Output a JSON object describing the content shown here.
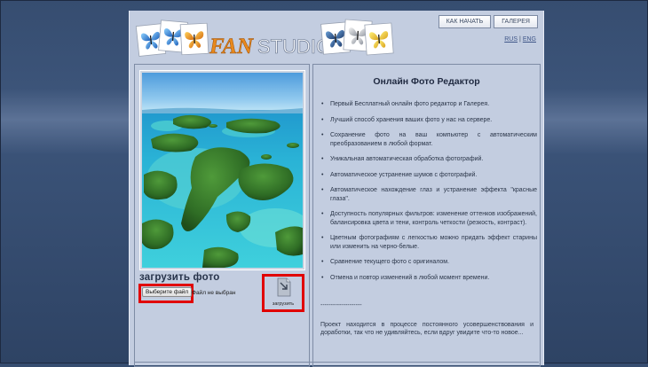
{
  "header": {
    "brand_fan": "FAN",
    "brand_studio": "STUDIO",
    "nav": [
      "КАК НАЧАТЬ",
      "ГАЛЕРЕЯ"
    ],
    "lang": [
      "RUS",
      "ENG"
    ]
  },
  "left": {
    "upload_title": "загрузить фото",
    "file_button": "Выберите файл",
    "file_status": "Файл не выбран",
    "upload_button": "загрузить"
  },
  "right": {
    "title": "Онлайн Фото Редактор",
    "features": [
      "Первый Бесплатный онлайн фото редактор и Галерея.",
      "Лучший способ хранения ваших фото у нас на сервере.",
      "Сохранение фото на ваш компьютер с автоматическим преобразованием в любой формат.",
      "Уникальная автоматическая обработка фотографий.",
      "Автоматическое устранение шумов с фотографий.",
      "Автоматическое нахождение глаз и устранение эффекта \"красные глаза\".",
      "Доступность популярных фильтров: изменение оттенков изображений, балансировка цвета и тени, контроль четкости (резкость, контраст).",
      "Цветным фотографиям с легкостью можно придать эффект старины или изменить на черно-белые.",
      "Сравнение текущего фото с оригиналом.",
      "Отмена и повтор изменений в любой момент времени."
    ],
    "divider": "--------------------",
    "note": "Проект находится в процессе постоянного усовершенствования и доработки, так что не удивляйтесь, если вдруг увидите что-то новое..."
  },
  "colors": {
    "page_bg": "#c3cde0",
    "outer_bg": "#364d70",
    "highlight": "#e10000",
    "brand_orange": "#e8891c"
  },
  "icons": [
    "butterfly-icon",
    "upload-icon"
  ]
}
